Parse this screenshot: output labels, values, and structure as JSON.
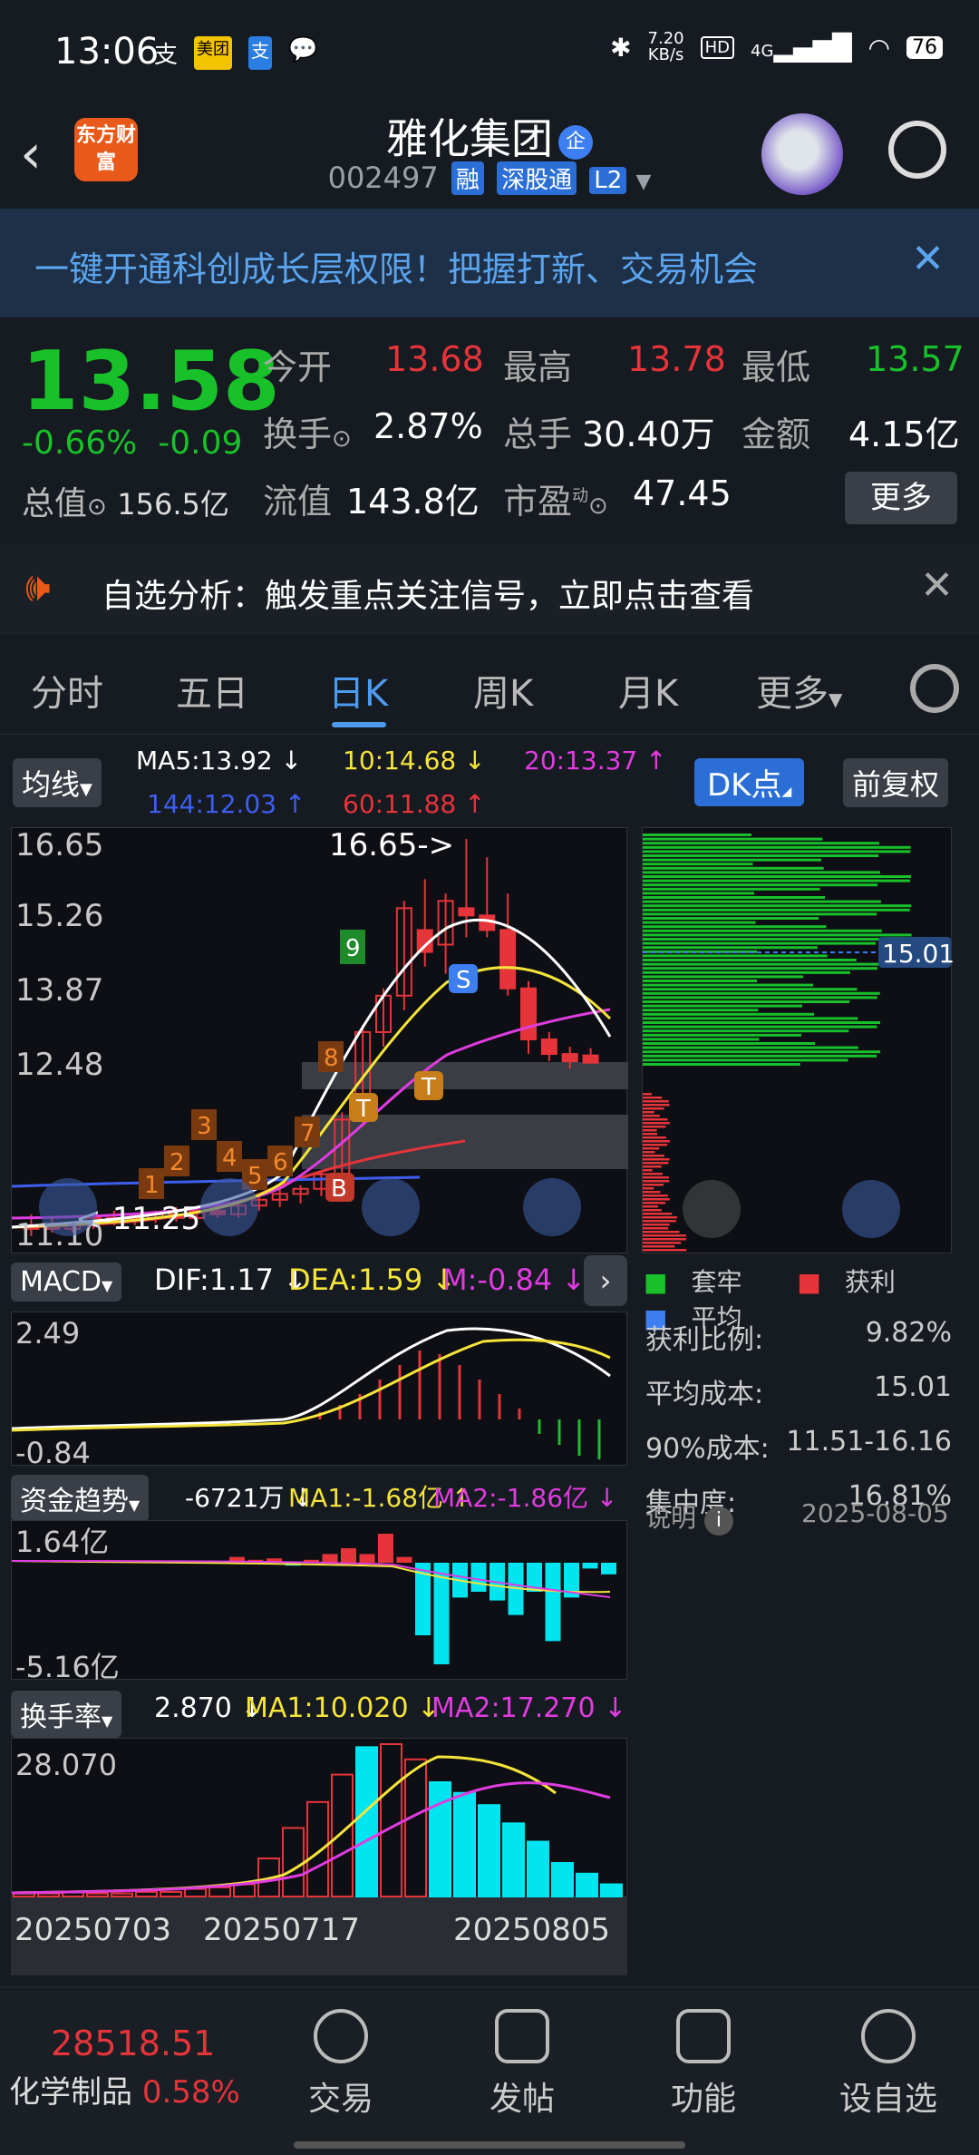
{
  "status_bar": {
    "time": "13:06",
    "speed": "7.20\nKB/s",
    "battery": "76",
    "network": "4G"
  },
  "header": {
    "logo": "东方财富",
    "title": "雅化集团",
    "badge": "企",
    "code": "002497",
    "tags": [
      "融",
      "深股通",
      "L2"
    ]
  },
  "banner": {
    "text": "一键开通科创成长层权限！把握打新、交易机会",
    "close": "✕"
  },
  "quote": {
    "price": "13.58",
    "change_pct": "-0.66%",
    "change": "-0.09",
    "open_label": "今开",
    "open": "13.68",
    "high_label": "最高",
    "high": "13.78",
    "low_label": "最低",
    "low": "13.57",
    "turnover_label": "换手",
    "turnover": "2.87%",
    "volume_label": "总手",
    "volume": "30.40万",
    "amount_label": "金额",
    "amount": "4.15亿",
    "mktcap_label": "总值",
    "mktcap": "156.5亿",
    "float_label": "流值",
    "float": "143.8亿",
    "pe_label": "市盈",
    "pe_sup": "动",
    "pe": "47.45",
    "more": "更多"
  },
  "notice": {
    "text": "自选分析：触发重点关注信号，立即点击查看"
  },
  "tabs": [
    "分时",
    "五日",
    "日K",
    "周K",
    "月K",
    "更多"
  ],
  "kline": {
    "ma_label": "均线",
    "ma5": "MA5:13.92 ↓",
    "ma10": "10:14.68 ↓",
    "ma20": "20:13.37 ↑",
    "ma144": "144:12.03 ↑",
    "ma60": "60:11.88 ↑",
    "dk": "DK点",
    "fq": "前复权",
    "y_labels": [
      "16.65",
      "15.26",
      "13.87",
      "12.48",
      "11.10"
    ],
    "high_mark": "16.65->",
    "low_mark": "<-11.25",
    "signals": [
      "1",
      "2",
      "3",
      "4",
      "5",
      "6",
      "7",
      "8",
      "9"
    ],
    "markers": [
      "B",
      "T",
      "T",
      "S"
    ]
  },
  "chips": {
    "avg_label": "15.01",
    "legend": [
      "套牢",
      "获利",
      "平均"
    ],
    "stats": [
      {
        "k": "获利比例:",
        "v": "9.82%"
      },
      {
        "k": "平均成本:",
        "v": "15.01"
      },
      {
        "k": "90%成本:",
        "v": "11.51-16.16"
      },
      {
        "k": "集中度:",
        "v": "16.81%"
      }
    ],
    "note_label": "说明",
    "date": "2025-08-05"
  },
  "macd": {
    "label": "MACD",
    "dif": "DIF:1.17 ↓",
    "dea": "DEA:1.59 ↓",
    "m": "M:-0.84 ↓",
    "y_top": "2.49",
    "y_bottom": "-0.84"
  },
  "fund": {
    "label": "资金趋势",
    "v": "-6721万 ↓",
    "ma1": "MA1:-1.68亿 ↑",
    "ma2": "MA2:-1.86亿 ↓",
    "y_top": "1.64亿",
    "y_bottom": "-5.16亿"
  },
  "turn": {
    "label": "换手率",
    "v": "2.870 ↓",
    "ma1": "MA1:10.020 ↓",
    "ma2": "MA2:17.270 ↓",
    "y_top": "28.070"
  },
  "dates": [
    "20250703",
    "20250717",
    "20250805"
  ],
  "bottom_nav": {
    "index_value": "28518.51",
    "index_name": "化学制品",
    "index_pct": "0.58%",
    "items": [
      "交易",
      "发帖",
      "功能",
      "设自选"
    ]
  },
  "chart_data": {
    "type": "candlestick",
    "candles": [
      {
        "o": 11.3,
        "h": 11.5,
        "l": 11.2,
        "c": 11.35,
        "up": true
      },
      {
        "o": 11.35,
        "h": 11.45,
        "l": 11.25,
        "c": 11.3,
        "up": false
      },
      {
        "o": 11.3,
        "h": 11.4,
        "l": 11.25,
        "c": 11.38,
        "up": true
      },
      {
        "o": 11.38,
        "h": 11.5,
        "l": 11.3,
        "c": 11.45,
        "up": true
      },
      {
        "o": 11.45,
        "h": 11.55,
        "l": 11.35,
        "c": 11.42,
        "up": false
      },
      {
        "o": 11.42,
        "h": 11.5,
        "l": 11.35,
        "c": 11.45,
        "up": true
      },
      {
        "o": 11.45,
        "h": 11.55,
        "l": 11.38,
        "c": 11.5,
        "up": true
      },
      {
        "o": 11.5,
        "h": 11.6,
        "l": 11.4,
        "c": 11.45,
        "up": false
      },
      {
        "o": 11.45,
        "h": 11.6,
        "l": 11.4,
        "c": 11.55,
        "up": true
      },
      {
        "o": 11.55,
        "h": 11.65,
        "l": 11.45,
        "c": 11.5,
        "up": false
      },
      {
        "o": 11.5,
        "h": 11.65,
        "l": 11.45,
        "c": 11.62,
        "up": true
      },
      {
        "o": 11.62,
        "h": 11.75,
        "l": 11.55,
        "c": 11.7,
        "up": true
      },
      {
        "o": 11.7,
        "h": 11.85,
        "l": 11.6,
        "c": 11.78,
        "up": true
      },
      {
        "o": 11.78,
        "h": 11.9,
        "l": 11.65,
        "c": 11.85,
        "up": true
      },
      {
        "o": 11.85,
        "h": 12.1,
        "l": 11.75,
        "c": 12.05,
        "up": true
      },
      {
        "o": 12.05,
        "h": 12.9,
        "l": 11.95,
        "c": 12.8,
        "up": true
      },
      {
        "o": 12.8,
        "h": 14.1,
        "l": 12.7,
        "c": 14.0,
        "up": true
      },
      {
        "o": 14.0,
        "h": 14.6,
        "l": 13.8,
        "c": 14.5,
        "up": true
      },
      {
        "o": 14.5,
        "h": 15.8,
        "l": 14.3,
        "c": 15.7,
        "up": true
      },
      {
        "o": 15.4,
        "h": 16.1,
        "l": 14.9,
        "c": 15.1,
        "up": false
      },
      {
        "o": 15.2,
        "h": 15.9,
        "l": 14.8,
        "c": 15.8,
        "up": true
      },
      {
        "o": 15.7,
        "h": 16.65,
        "l": 15.3,
        "c": 15.6,
        "up": false
      },
      {
        "o": 15.6,
        "h": 16.4,
        "l": 15.3,
        "c": 15.4,
        "up": false
      },
      {
        "o": 15.4,
        "h": 15.9,
        "l": 14.5,
        "c": 14.6,
        "up": false
      },
      {
        "o": 14.6,
        "h": 14.7,
        "l": 13.7,
        "c": 13.9,
        "up": false
      },
      {
        "o": 13.9,
        "h": 14.0,
        "l": 13.6,
        "c": 13.7,
        "up": false
      },
      {
        "o": 13.7,
        "h": 13.8,
        "l": 13.5,
        "c": 13.6,
        "up": false
      },
      {
        "o": 13.68,
        "h": 13.78,
        "l": 13.57,
        "c": 13.58,
        "up": false
      }
    ],
    "ymin": 11.1,
    "ymax": 16.65
  }
}
